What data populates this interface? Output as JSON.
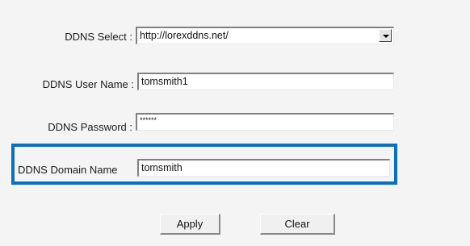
{
  "form": {
    "ddns_select": {
      "label": "DDNS Select :",
      "value": "http://lorexddns.net/"
    },
    "ddns_user_name": {
      "label": "DDNS User Name :",
      "value": "tomsmith1"
    },
    "ddns_password": {
      "label": "DDNS Password :",
      "value": "******"
    },
    "ddns_domain_name": {
      "label": "DDNS Domain Name",
      "value": "tomsmith"
    }
  },
  "buttons": {
    "apply_label": "Apply",
    "clear_label": "Clear"
  },
  "colors": {
    "highlight": "#0a6fc4",
    "background": "#f4f4f4"
  }
}
